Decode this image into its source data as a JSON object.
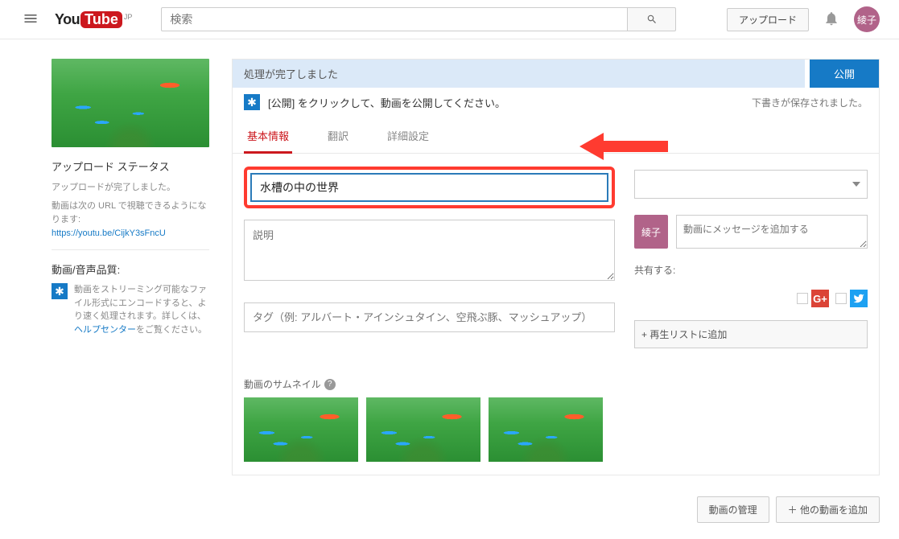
{
  "header": {
    "logo_region": "JP",
    "search_placeholder": "検索",
    "upload_button": "アップロード",
    "avatar_label": "綾子"
  },
  "left": {
    "status_heading": "アップロード ステータス",
    "status_done": "アップロードが完了しました。",
    "url_intro": "動画は次の URL で視聴できるようになります:",
    "url": "https://youtu.be/CijkY3sFncU",
    "quality_heading": "動画/音声品質:",
    "quality_body_a": "動画をストリーミング可能なファイル形式にエンコードすると、より速く処理されます。詳しくは、",
    "quality_help": "ヘルプセンター",
    "quality_body_b": "をご覧ください。"
  },
  "main": {
    "processing_done": "処理が完了しました",
    "publish": "公開",
    "publish_hint": "[公開] をクリックして、動画を公開してください。",
    "draft_saved": "下書きが保存されました。",
    "tabs": {
      "basic": "基本情報",
      "translate": "翻訳",
      "advanced": "詳細設定"
    },
    "title_value": "水槽の中の世界",
    "desc_placeholder": "説明",
    "tag_placeholder": "タグ（例: アルバート・アインシュタイン、空飛ぶ豚、マッシュアップ）",
    "thumbs_label": "動画のサムネイル"
  },
  "right": {
    "avatar_label": "綾子",
    "msg_placeholder": "動画にメッセージを追加する",
    "share_label": "共有する:",
    "playlist_add": "+ 再生リストに追加"
  },
  "footer": {
    "manage": "動画の管理",
    "add_more": "＋ 他の動画を追加"
  }
}
